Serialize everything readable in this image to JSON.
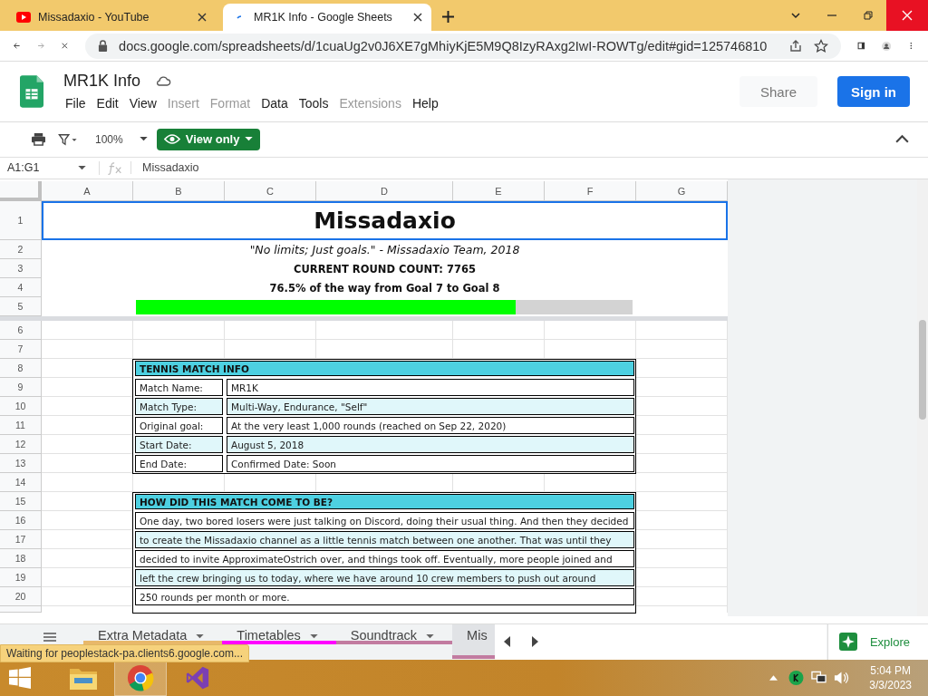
{
  "browser_tabs": [
    {
      "title": "Missadaxio - YouTube",
      "kind": "youtube",
      "selected": false
    },
    {
      "title": "MR1K Info - Google Sheets",
      "kind": "sheets",
      "selected": true
    }
  ],
  "url": "docs.google.com/spreadsheets/d/1cuaUg2v0J6XE7gMhiyKjE5M9Q8IzyRAxg2IwI-ROWTg/edit#gid=125746810",
  "doc": {
    "title": "MR1K Info",
    "menus": [
      {
        "label": "File",
        "disabled": false
      },
      {
        "label": "Edit",
        "disabled": false
      },
      {
        "label": "View",
        "disabled": false
      },
      {
        "label": "Insert",
        "disabled": true
      },
      {
        "label": "Format",
        "disabled": true
      },
      {
        "label": "Data",
        "disabled": false
      },
      {
        "label": "Tools",
        "disabled": false
      },
      {
        "label": "Extensions",
        "disabled": true
      },
      {
        "label": "Help",
        "disabled": false
      }
    ],
    "share": "Share",
    "sign_in": "Sign in"
  },
  "toolbar": {
    "zoom": "100%",
    "view_only": "View only"
  },
  "formula_bar": {
    "cell_ref": "A1:G1",
    "content": "Missadaxio"
  },
  "columns": [
    "A",
    "B",
    "C",
    "D",
    "E",
    "F",
    "G"
  ],
  "rows": [
    "1",
    "2",
    "3",
    "4",
    "5",
    "6",
    "7",
    "8",
    "9",
    "10",
    "11",
    "12",
    "13",
    "14",
    "15",
    "16",
    "17",
    "18",
    "19",
    "20"
  ],
  "sheet": {
    "title": "Missadaxio",
    "quote": "\"No limits; Just goals.\" - Missadaxio Team, 2018",
    "round_count": "CURRENT ROUND COUNT: 7765",
    "progress_text": "76.5% of the way from Goal 7 to Goal 8",
    "progress": {
      "level": 0.765
    },
    "match_info": {
      "header": "TENNIS MATCH INFO",
      "rows": [
        {
          "label": "Match Name:",
          "value": "MR1K"
        },
        {
          "label": "Match Type:",
          "value": "Multi-Way, Endurance, \"Self\""
        },
        {
          "label": "Original goal:",
          "value": "At the very least 1,000 rounds (reached on Sep 22, 2020)"
        },
        {
          "label": "Start Date:",
          "value": "August 5, 2018"
        },
        {
          "label": "End Date:",
          "value": "Confirmed Date: Soon"
        }
      ]
    },
    "story": {
      "header": "HOW DID THIS MATCH COME TO BE?",
      "lines": [
        "One day, two bored losers were just talking on Discord, doing their usual thing. And then they decided",
        "to create the Missadaxio channel as a little tennis match between one another. That was until they",
        "decided to invite ApproximateOstrich over, and things took off. Eventually, more people joined and",
        "left the crew bringing us to today, where we have around 10 crew members to push out around",
        "250 rounds per month or more."
      ]
    }
  },
  "sheet_tabs": [
    {
      "label": "Extra Metadata",
      "color": "#e8b86a",
      "selected": false
    },
    {
      "label": "Timetables",
      "color": "#ff00ff",
      "selected": false
    },
    {
      "label": "Soundtrack",
      "color": "#c27ba0",
      "selected": false
    },
    {
      "label": "Mis",
      "color": "#c27ba0",
      "selected": true
    }
  ],
  "explore": "Explore",
  "status": "Waiting for peoplestack-pa.clients6.google.com...",
  "clock": {
    "time": "5:04 PM",
    "date": "3/3/2023"
  }
}
